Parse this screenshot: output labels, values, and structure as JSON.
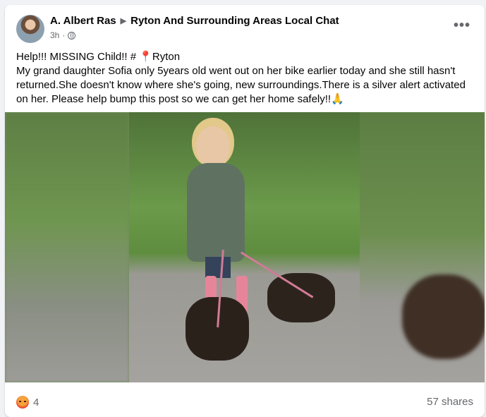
{
  "post": {
    "author": "A. Albert Ras",
    "group": "Ryton And Surrounding Areas Local Chat",
    "time": "3h",
    "text_line1_prefix": "Help!!! MISSING Child!! # ",
    "text_line1_place": "Ryton",
    "text_body": "My grand daughter Sofia only 5years old went out on her bike earlier today and she still hasn't returned.She doesn't know where she's going, new surroundings.There is a silver alert activated on her. Please help bump this post so we can get her home safely!!🙏"
  },
  "footer": {
    "reaction_count": "4",
    "shares": "57 shares"
  },
  "icons": {
    "group_caret": "caret-right-icon",
    "privacy": "globe-icon",
    "menu": "more-options-icon",
    "pin": "map-pin-icon",
    "reaction": "angry-reaction-icon"
  }
}
